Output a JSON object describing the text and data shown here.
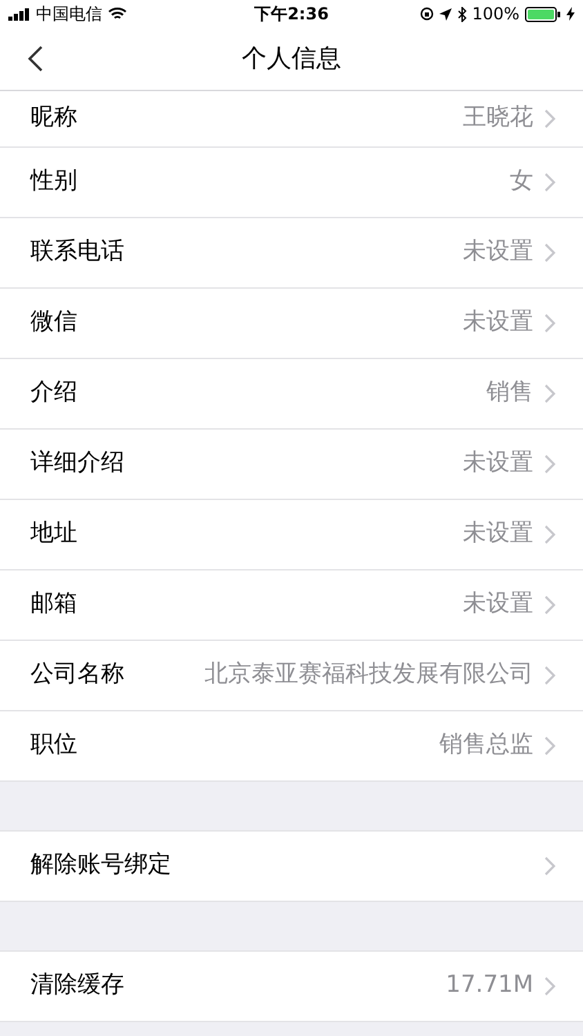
{
  "status_bar": {
    "carrier": "中国电信",
    "time": "下午2:36",
    "battery": "100%"
  },
  "nav": {
    "title": "个人信息"
  },
  "sections": [
    {
      "rows": [
        {
          "label": "昵称",
          "value": "王晓花"
        },
        {
          "label": "性别",
          "value": "女"
        },
        {
          "label": "联系电话",
          "value": "未设置"
        },
        {
          "label": "微信",
          "value": "未设置"
        },
        {
          "label": "介绍",
          "value": "销售"
        },
        {
          "label": "详细介绍",
          "value": "未设置"
        },
        {
          "label": "地址",
          "value": "未设置"
        },
        {
          "label": "邮箱",
          "value": "未设置"
        },
        {
          "label": "公司名称",
          "value": "北京泰亚赛福科技发展有限公司"
        },
        {
          "label": "职位",
          "value": "销售总监"
        }
      ]
    },
    {
      "rows": [
        {
          "label": "解除账号绑定"
        }
      ]
    },
    {
      "rows": [
        {
          "label": "清除缓存",
          "value": "17.71M"
        }
      ]
    }
  ]
}
